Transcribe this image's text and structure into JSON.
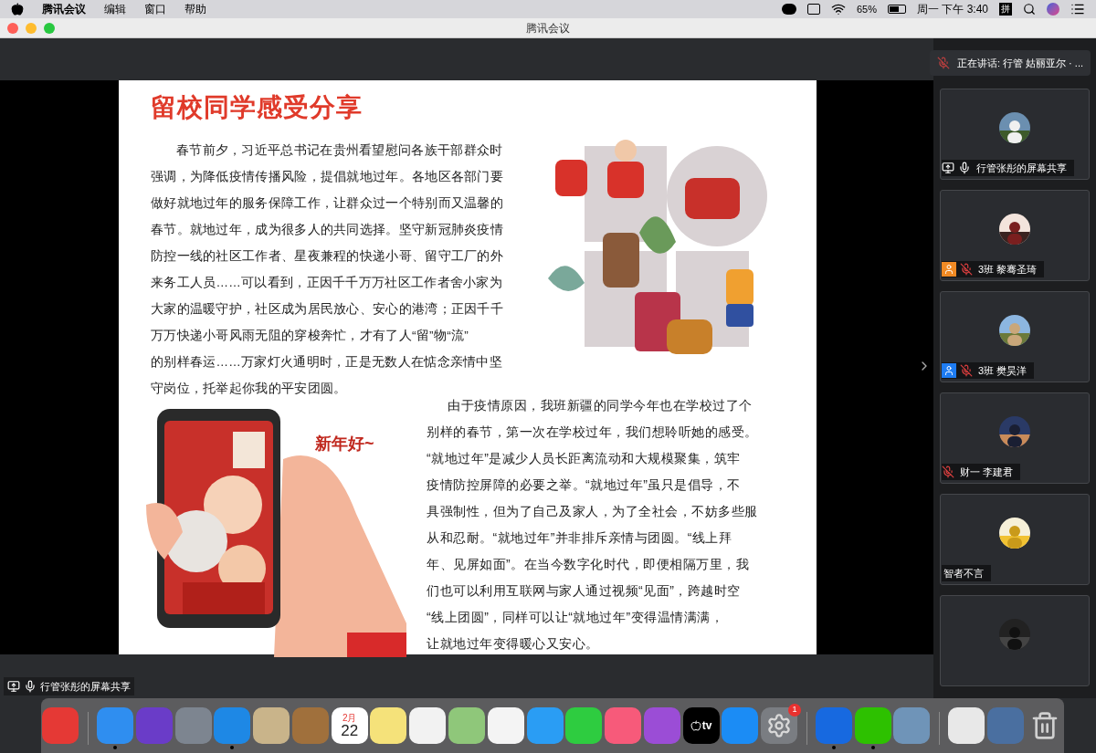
{
  "menu_bar": {
    "app": "腾讯会议",
    "items": [
      "编辑",
      "窗口",
      "帮助"
    ],
    "battery": "65%",
    "clock": "周一 下午 3:40",
    "input_method": "拼"
  },
  "window": {
    "title": "腾讯会议"
  },
  "speaking_toast": "正在讲话: 行管 姑丽亚尔 · ...",
  "slide": {
    "title": "留校同学感受分享",
    "greeting": "新年好~",
    "paragraphs": [
      {
        "lines": [
          "春节前夕，习近平总书记在贵州看望慰问各族干部群众时",
          "强调，为降低疫情传播风险，提倡就地过年。各地区各部门要",
          "做好就地过年的服务保障工作，让群众过一个特别而又温馨的",
          "春节。就地过年，成为很多人的共同选择。坚守新冠肺炎疫情",
          "防控一线的社区工作者、星夜兼程的快递小哥、留守工厂的外",
          "来务工人员……可以看到，正因千千万万社区工作者舍小家为",
          "大家的温暖守护，社区成为居民放心、安心的港湾；正因千千",
          "万万快递小哥风雨无阻的穿梭奔忙，才有了人“留”物“流”",
          "的别样春运……万家灯火通明时，正是无数人在惦念亲情中坚",
          "守岗位，托举起你我的平安团圆。"
        ]
      },
      {
        "lines": [
          "由于疫情原因，我班新疆的同学今年也在学校过了个",
          "别样的春节，第一次在学校过年，我们想聆听她的感受。",
          "“就地过年”是减少人员长距离流动和大规模聚集，筑牢",
          "疫情防控屏障的必要之举。“就地过年”虽只是倡导，不",
          "具强制性，但为了自己及家人，为了全社会，不妨多些服",
          "从和忍耐。“就地过年”并非排斥亲情与团圆。“线上拜",
          "年、见屏如面”。在当今数字化时代，即便相隔万里，我",
          "们也可以利用互联网与家人通过视频“见面”，跨越时空",
          "“线上团圆”，同样可以让“就地过年”变得温情满满，",
          "让就地过年变得暖心又安心。"
        ]
      }
    ]
  },
  "participants": [
    {
      "name": "行管张彤的屏幕共享",
      "sharing": true,
      "mic_muted": false
    },
    {
      "name": "3班 黎骞圣琦",
      "sharing": false,
      "color": "#f08a24",
      "mic_muted": true
    },
    {
      "name": "3班 樊昊洋",
      "sharing": false,
      "color": "#1e7cf2",
      "mic_muted": true
    },
    {
      "name": "财一 李建君",
      "sharing": false,
      "mic_muted": true
    },
    {
      "name": "智者不言",
      "sharing": false
    },
    {
      "avatar_only": true
    }
  ],
  "share_label": "行管张彤的屏幕共享",
  "dock": [
    {
      "kind": "app",
      "color": "#e53935",
      "running": false
    },
    {
      "kind": "divider"
    },
    {
      "kind": "app",
      "color": "#2f8ef0",
      "running": true
    },
    {
      "kind": "app",
      "color": "#6a3cc8",
      "running": false
    },
    {
      "kind": "app",
      "color": "#7d8590",
      "running": false
    },
    {
      "kind": "app",
      "color": "#1e88e5",
      "running": true
    },
    {
      "kind": "app",
      "color": "#c9b48a",
      "running": false
    },
    {
      "kind": "app",
      "color": "#a0703c",
      "running": false
    },
    {
      "kind": "calendar",
      "month": "2月",
      "day": "22",
      "running": false
    },
    {
      "kind": "app",
      "color": "#f5e27a",
      "running": false
    },
    {
      "kind": "app",
      "color": "#f2f2f2",
      "running": false
    },
    {
      "kind": "app",
      "color": "#8fc77a",
      "running": false
    },
    {
      "kind": "app",
      "color": "#f4f4f4",
      "running": false
    },
    {
      "kind": "app",
      "color": "#2a9df4",
      "running": false
    },
    {
      "kind": "app",
      "color": "#2ecc40",
      "running": false
    },
    {
      "kind": "app",
      "color": "#f75a7a",
      "running": false
    },
    {
      "kind": "app",
      "color": "#9b4dd6",
      "running": false
    },
    {
      "kind": "tv",
      "label": "tv",
      "running": false
    },
    {
      "kind": "app",
      "color": "#1b8cf5",
      "running": false
    },
    {
      "kind": "settings",
      "badge": "1",
      "running": false
    },
    {
      "kind": "divider"
    },
    {
      "kind": "app",
      "color": "#1769e0",
      "running": true
    },
    {
      "kind": "app",
      "color": "#2dc100",
      "running": true
    },
    {
      "kind": "app",
      "color": "#6f94b8",
      "running": false
    },
    {
      "kind": "divider"
    },
    {
      "kind": "app",
      "color": "#e8e8e8",
      "running": false
    },
    {
      "kind": "app",
      "color": "#4a6fa0",
      "running": false
    },
    {
      "kind": "trash",
      "running": false
    }
  ]
}
